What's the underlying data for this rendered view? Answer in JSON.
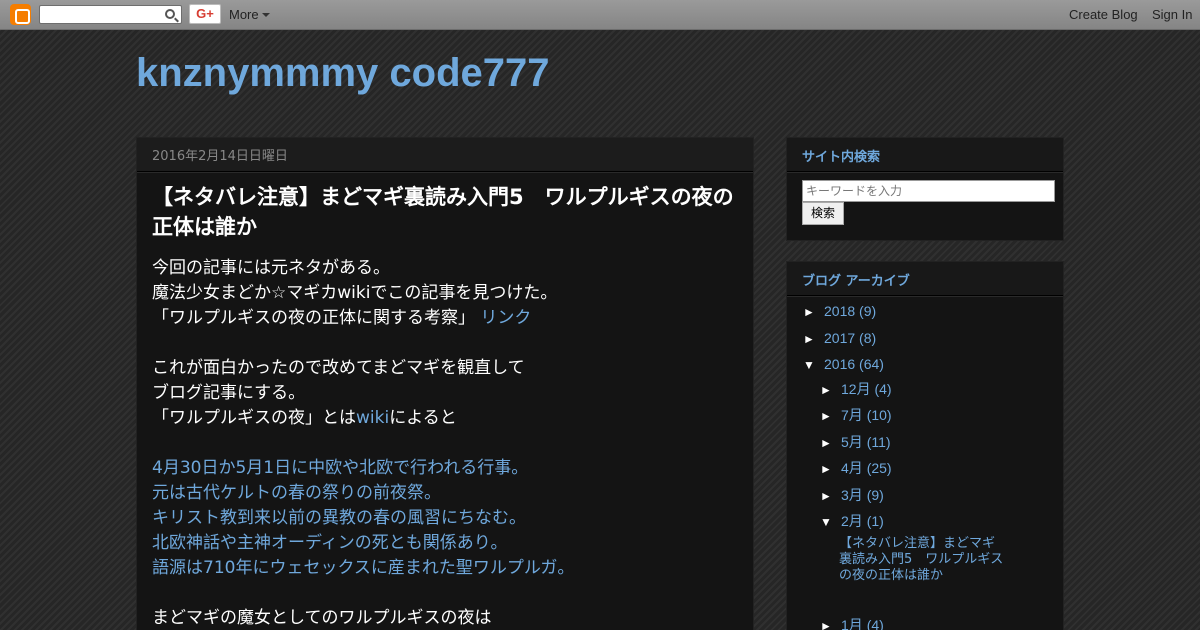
{
  "navbar": {
    "logo_icon": "blogger-icon",
    "search_icon": "search-icon",
    "gplus_label": "G+",
    "more_label": "More",
    "create_blog": "Create Blog",
    "sign_in": "Sign In"
  },
  "blog": {
    "title": "knznymmmy code777"
  },
  "post": {
    "date": "2016年2月14日日曜日",
    "title": "【ネタバレ注意】まどマギ裏読み入門5　ワルプルギスの夜の正体は誰か",
    "body": {
      "p1_line1": "今回の記事には元ネタがある。",
      "p1_line2": "魔法少女まどか☆マギカwikiでこの記事を見つけた。",
      "p1_line3": "「ワルプルギスの夜の正体に関する考察」",
      "p1_link": "リンク",
      "p2_line1": "これが面白かったので改めてまどマギを観直して",
      "p2_line2": "ブログ記事にする。",
      "p2_line3_pre": "「ワルプルギスの夜」とは",
      "p2_line3_link": "wiki",
      "p2_line3_post": "によると",
      "p3_line1": "4月30日か5月1日に中欧や北欧で行われる行事。",
      "p3_line2": "元は古代ケルトの春の祭りの前夜祭。",
      "p3_line3": "キリスト教到来以前の異教の春の風習にちなむ。",
      "p3_line4": "北欧神話や主神オーディンの死とも関係あり。",
      "p3_line5": "語源は710年にウェセックスに産まれた聖ワルプルガ。",
      "p4_line1": "まどマギの魔女としてのワルプルギスの夜は"
    }
  },
  "sidebar": {
    "search": {
      "title": "サイト内検索",
      "placeholder": "キーワードを入力",
      "button": "検索"
    },
    "archive": {
      "title": "ブログ アーカイブ",
      "years": [
        {
          "toggle": "►",
          "label": "2018",
          "count": "(9)"
        },
        {
          "toggle": "►",
          "label": "2017",
          "count": "(8)"
        },
        {
          "toggle": "▼",
          "label": "2016",
          "count": "(64)"
        }
      ],
      "months": [
        {
          "toggle": "►",
          "label": "12月",
          "count": "(4)"
        },
        {
          "toggle": "►",
          "label": "7月",
          "count": "(10)"
        },
        {
          "toggle": "►",
          "label": "5月",
          "count": "(11)"
        },
        {
          "toggle": "►",
          "label": "4月",
          "count": "(25)"
        },
        {
          "toggle": "►",
          "label": "3月",
          "count": "(9)"
        },
        {
          "toggle": "▼",
          "label": "2月",
          "count": "(1)"
        },
        {
          "toggle": "►",
          "label": "1月",
          "count": "(4)"
        }
      ],
      "post_title": "【ネタバレ注意】まどマギ裏読み入門5　ワルプルギスの夜の正体は誰か"
    }
  }
}
